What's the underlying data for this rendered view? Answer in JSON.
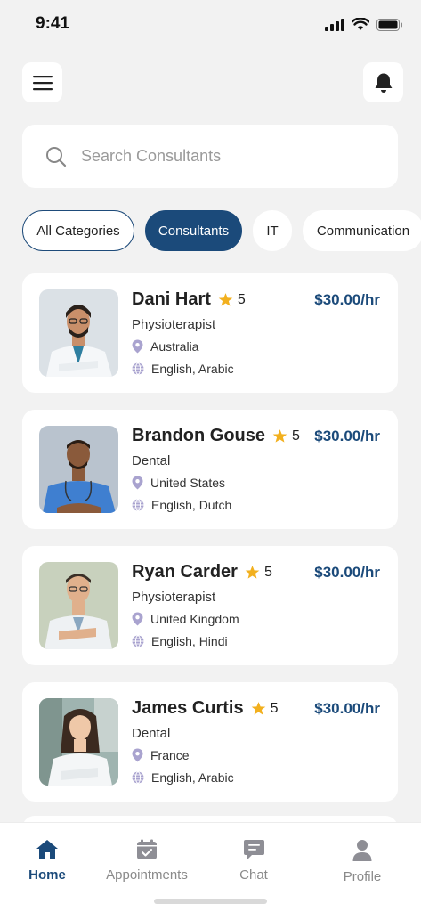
{
  "status": {
    "time": "9:41"
  },
  "search": {
    "placeholder": "Search Consultants"
  },
  "categories": [
    "All Categories",
    "Consultants",
    "IT",
    "Communication"
  ],
  "consultants": [
    {
      "name": "Dani Hart",
      "rating": "5",
      "price": "$30.00/hr",
      "specialty": "Physioterapist",
      "location": "Australia",
      "languages": "English, Arabic"
    },
    {
      "name": "Brandon Gouse",
      "rating": "5",
      "price": "$30.00/hr",
      "specialty": "Dental",
      "location": "United States",
      "languages": "English, Dutch"
    },
    {
      "name": "Ryan Carder",
      "rating": "5",
      "price": "$30.00/hr",
      "specialty": "Physioterapist",
      "location": "United Kingdom",
      "languages": "English, Hindi"
    },
    {
      "name": "James Curtis",
      "rating": "5",
      "price": "$30.00/hr",
      "specialty": "Dental",
      "location": "France",
      "languages": "English, Arabic"
    }
  ],
  "nav": {
    "home": "Home",
    "appointments": "Appointments",
    "chat": "Chat",
    "profile": "Profile"
  },
  "colors": {
    "primary": "#1b4a7a",
    "star": "#f2b01e",
    "icon": "#a9a3cf",
    "background": "#f2f2f2"
  }
}
